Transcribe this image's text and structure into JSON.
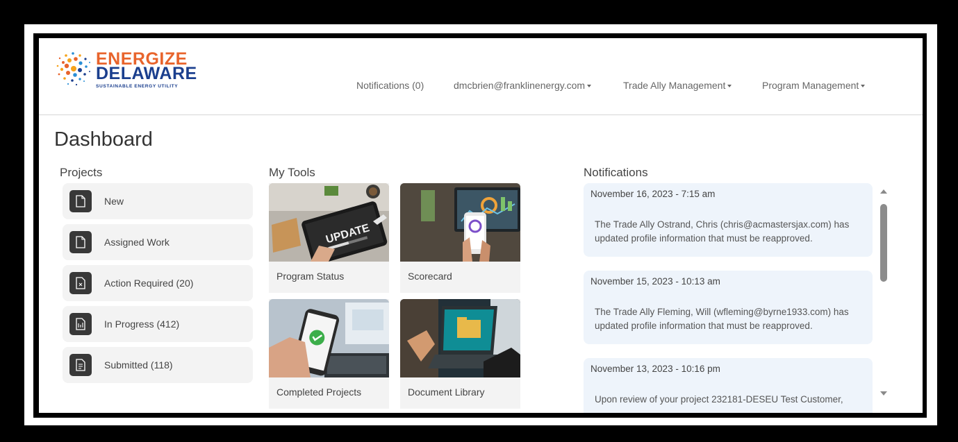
{
  "brand": {
    "line1": "ENERGIZE",
    "line2": "DELAWARE",
    "tagline": "SUSTAINABLE ENERGY UTILITY",
    "orange": "#e8642c",
    "blue": "#1b3f8e"
  },
  "nav": {
    "notifications": "Notifications (0)",
    "user": "dmcbrien@franklinenergy.com",
    "trade_ally": "Trade Ally Management",
    "program": "Program Management"
  },
  "page": {
    "title": "Dashboard"
  },
  "projects": {
    "title": "Projects",
    "items": [
      {
        "label": "New",
        "icon": "file-icon"
      },
      {
        "label": "Assigned Work",
        "icon": "file-icon"
      },
      {
        "label": "Action Required (20)",
        "icon": "file-alert-icon"
      },
      {
        "label": "In Progress (412)",
        "icon": "file-progress-icon"
      },
      {
        "label": "Submitted (118)",
        "icon": "file-check-icon"
      }
    ]
  },
  "tools": {
    "title": "My Tools",
    "items": [
      {
        "label": "Program Status",
        "image": "tablet-update-photo",
        "overlay": "UPDATE"
      },
      {
        "label": "Scorecard",
        "image": "phone-analytics-photo"
      },
      {
        "label": "Completed Projects",
        "image": "phone-checkmark-photo"
      },
      {
        "label": "Document Library",
        "image": "laptop-folder-photo"
      }
    ]
  },
  "notifications": {
    "title": "Notifications",
    "items": [
      {
        "date": "November 16, 2023 - 7:15 am",
        "message": "The Trade Ally Ostrand, Chris (chris@acmastersjax.com) has updated profile information that must be reapproved."
      },
      {
        "date": "November 15, 2023 - 10:13 am",
        "message": "The Trade Ally Fleming, Will (wfleming@byrne1933.com) has updated profile information that must be reapproved."
      },
      {
        "date": "November 13, 2023 - 10:16 pm",
        "message": "Upon review of your project 232181-DESEU Test Customer,"
      }
    ]
  }
}
